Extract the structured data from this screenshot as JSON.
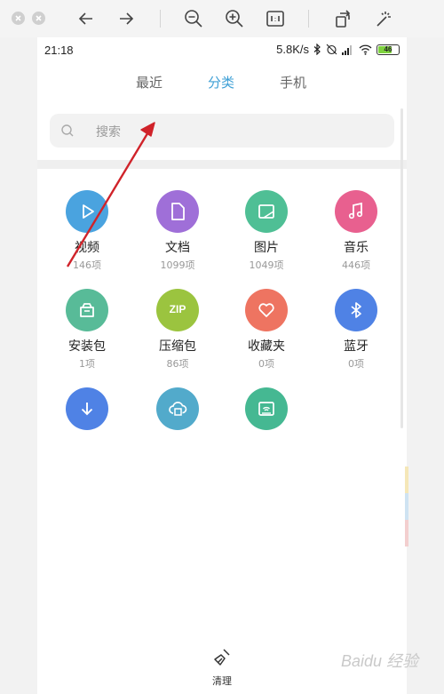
{
  "status_bar": {
    "time": "21:18",
    "speed": "5.8K/s",
    "battery": "46"
  },
  "tabs": [
    {
      "label": "最近",
      "active": false
    },
    {
      "label": "分类",
      "active": true
    },
    {
      "label": "手机",
      "active": false
    }
  ],
  "search": {
    "placeholder": "搜索"
  },
  "categories": [
    {
      "label": "视频",
      "count": "146项",
      "color": "#4aa3df",
      "icon": "play-icon"
    },
    {
      "label": "文档",
      "count": "1099项",
      "color": "#9f6fd8",
      "icon": "document-icon"
    },
    {
      "label": "图片",
      "count": "1049项",
      "color": "#4fbf95",
      "icon": "image-icon"
    },
    {
      "label": "音乐",
      "count": "446项",
      "color": "#e8608f",
      "icon": "music-icon"
    },
    {
      "label": "安装包",
      "count": "1项",
      "color": "#58bb98",
      "icon": "package-icon"
    },
    {
      "label": "压缩包",
      "count": "86项",
      "color": "#9bc43f",
      "icon": "zip-icon",
      "badge": "ZIP"
    },
    {
      "label": "收藏夹",
      "count": "0项",
      "color": "#ee7461",
      "icon": "heart-icon"
    },
    {
      "label": "蓝牙",
      "count": "0项",
      "color": "#4f82e5",
      "icon": "bluetooth-icon"
    },
    {
      "label": "",
      "count": "",
      "color": "#4f82e5",
      "icon": "download-icon"
    },
    {
      "label": "",
      "count": "",
      "color": "#52aacb",
      "icon": "cloud-icon"
    },
    {
      "label": "",
      "count": "",
      "color": "#45b892",
      "icon": "remote-icon"
    }
  ],
  "bottom": {
    "clean_label": "清理"
  },
  "watermark": "Baidu 经验",
  "colors": {
    "accent": "#3fa0d6",
    "annotation": "#d0232a"
  }
}
